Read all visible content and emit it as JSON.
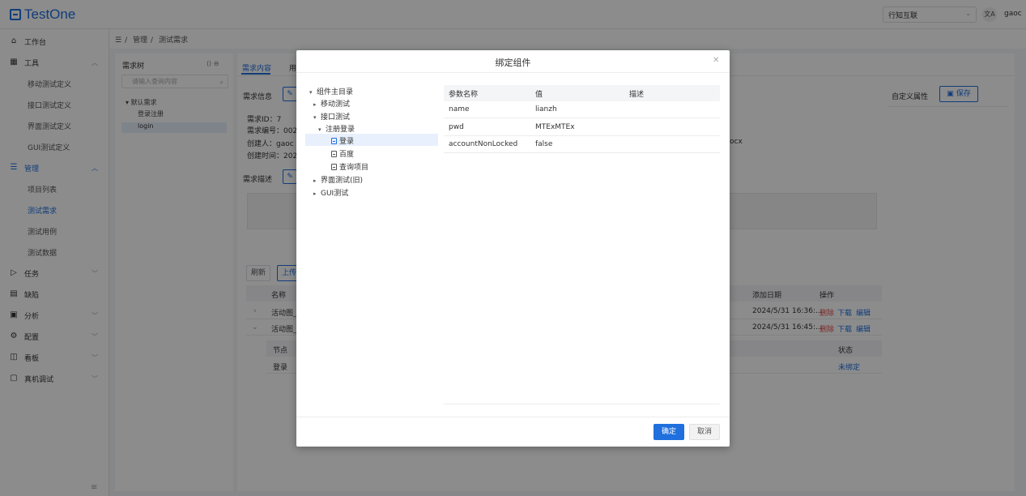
{
  "header": {
    "app_name": "TestOne",
    "org_select": "行知互联",
    "translate_label": "文A",
    "user": "gaoc"
  },
  "sidebar": {
    "workbench": "工作台",
    "tools": "工具",
    "tools_items": [
      "移动测试定义",
      "接口测试定义",
      "界面测试定义",
      "GUI测试定义"
    ],
    "manage": "管理",
    "manage_items": [
      "项目列表",
      "测试需求",
      "测试用例",
      "测试数据"
    ],
    "tasks": "任务",
    "defects": "缺陷",
    "analysis": "分析",
    "config": "配置",
    "dashboard": "看板",
    "device_test": "真机调试"
  },
  "breadcrumb": [
    "管理",
    "测试需求"
  ],
  "req_tree": {
    "title": "需求树",
    "search_placeholder": "请输入查询内容",
    "root": "默认需求",
    "children": [
      "登录注册",
      "login"
    ]
  },
  "content": {
    "tab_req": "需求内容",
    "tab_use": "用",
    "req_info": "需求信息",
    "id_label": "需求ID：7",
    "no_label": "需求编号：002",
    "creator_label": "创建人：gaoc",
    "created_label": "创建时间：202",
    "file_suffix": "ocx",
    "custom_attr": "自定义属性",
    "save": "保存",
    "req_desc": "需求描述",
    "refresh": "刷新",
    "upload": "上传",
    "col_name": "名称",
    "col_date": "添加日期",
    "col_op": "操作",
    "rows": [
      {
        "name": "活动图_2",
        "date": "2024/5/31 16:36:...",
        "del": "删除",
        "download": "下载",
        "edit": "编辑"
      },
      {
        "name": "活动图_2",
        "date": "2024/5/31 16:45:...",
        "del": "删除",
        "download": "下载",
        "edit": "编辑"
      }
    ],
    "sub_col_node": "节点",
    "sub_col_status": "状态",
    "sub_row_node": "登录",
    "sub_row_status": "未绑定"
  },
  "modal": {
    "title": "绑定组件",
    "tree": {
      "root": "组件主目录",
      "mobile": "移动测试",
      "api": "接口测试",
      "register_login": "注册登录",
      "login": "登录",
      "baidu": "百度",
      "query_project": "查询项目",
      "ui_old": "界面测试(旧)",
      "gui": "GUI测试"
    },
    "table": {
      "headers": [
        "参数名称",
        "值",
        "描述"
      ],
      "rows": [
        {
          "name": "name",
          "value": "lianzh",
          "desc": ""
        },
        {
          "name": "pwd",
          "value": "MTExMTEx",
          "desc": ""
        },
        {
          "name": "accountNonLocked",
          "value": "false",
          "desc": ""
        }
      ]
    },
    "ok": "确定",
    "cancel": "取消"
  },
  "colors": {
    "primary": "#1f6fde",
    "danger": "#e34d4d",
    "overlay": "rgba(0,0,0,0.45)"
  }
}
